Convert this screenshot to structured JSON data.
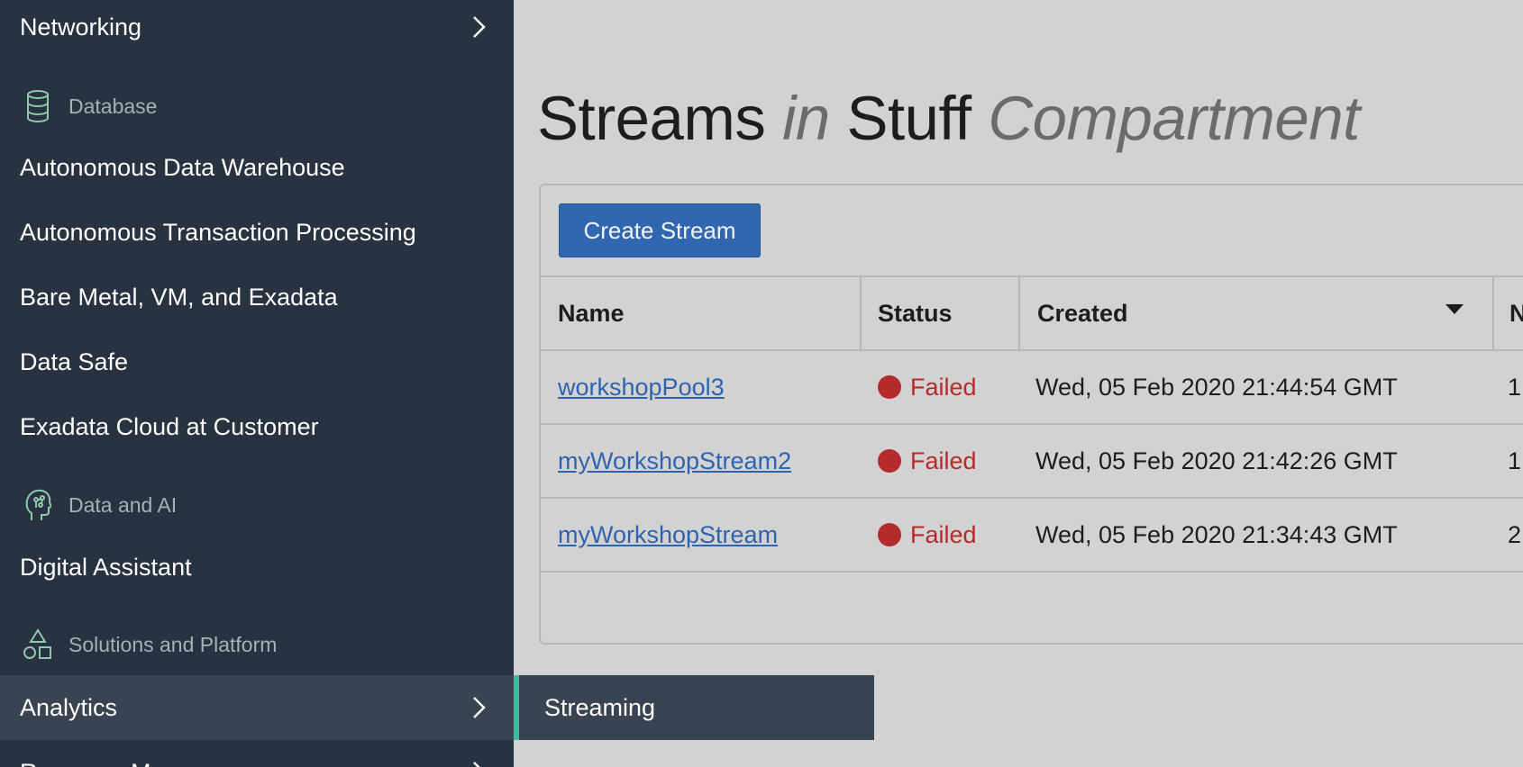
{
  "sidebar": {
    "networking_label": "Networking",
    "sections": {
      "database": "Database",
      "data_ai": "Data and AI",
      "solutions": "Solutions and Platform"
    },
    "database_items": [
      "Autonomous Data Warehouse",
      "Autonomous Transaction Processing",
      "Bare Metal, VM, and Exadata",
      "Data Safe",
      "Exadata Cloud at Customer"
    ],
    "data_ai_items": [
      "Digital Assistant"
    ],
    "analytics_label": "Analytics",
    "next_item_partial": "Resource M"
  },
  "flyout": {
    "streaming_label": "Streaming"
  },
  "page": {
    "title_part1": "Streams",
    "title_in": "in",
    "title_compartment_name": "Stuff",
    "title_part2": "Compartment"
  },
  "toolbar": {
    "create_label": "Create Stream"
  },
  "table": {
    "headers": {
      "name": "Name",
      "status": "Status",
      "created": "Created",
      "partial": "N"
    },
    "rows": [
      {
        "name": "workshopPool3",
        "status": "Failed",
        "created": "Wed, 05 Feb 2020 21:44:54 GMT",
        "partial": "1"
      },
      {
        "name": "myWorkshopStream2",
        "status": "Failed",
        "created": "Wed, 05 Feb 2020 21:42:26 GMT",
        "partial": "1"
      },
      {
        "name": "myWorkshopStream",
        "status": "Failed",
        "created": "Wed, 05 Feb 2020 21:34:43 GMT",
        "partial": "2"
      }
    ]
  },
  "colors": {
    "sidebar_bg": "#283241",
    "active_bg": "#394352",
    "accent": "#3fb8a0",
    "primary_button": "#3067b0",
    "failed": "#b52b2b",
    "link": "#2f63b0"
  }
}
